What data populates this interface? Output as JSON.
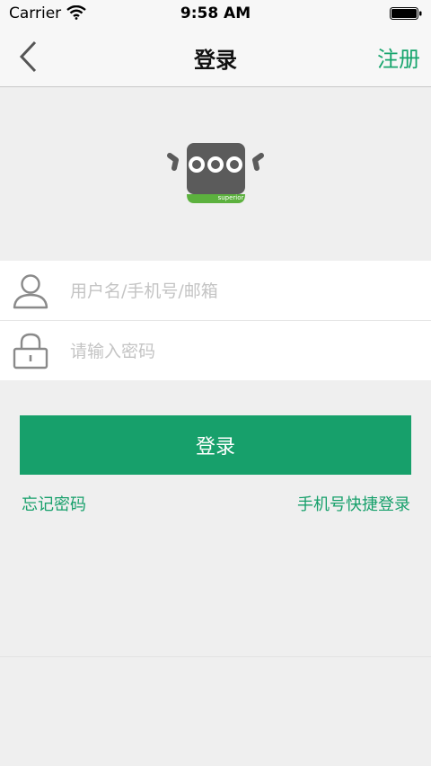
{
  "status_bar": {
    "carrier": "Carrier",
    "time": "9:58 AM"
  },
  "nav": {
    "title": "登录",
    "register_label": "注册"
  },
  "logo": {
    "brand_text": "superior"
  },
  "form": {
    "username_placeholder": "用户名/手机号/邮箱",
    "password_placeholder": "请输入密码"
  },
  "login_button_label": "登录",
  "links": {
    "forgot_password": "忘记密码",
    "quick_login": "手机号快捷登录"
  },
  "colors": {
    "accent": "#17a06b",
    "icon_gray": "#8a8a8a",
    "logo_body": "#5b5b5b",
    "logo_band": "#5cb13e"
  }
}
